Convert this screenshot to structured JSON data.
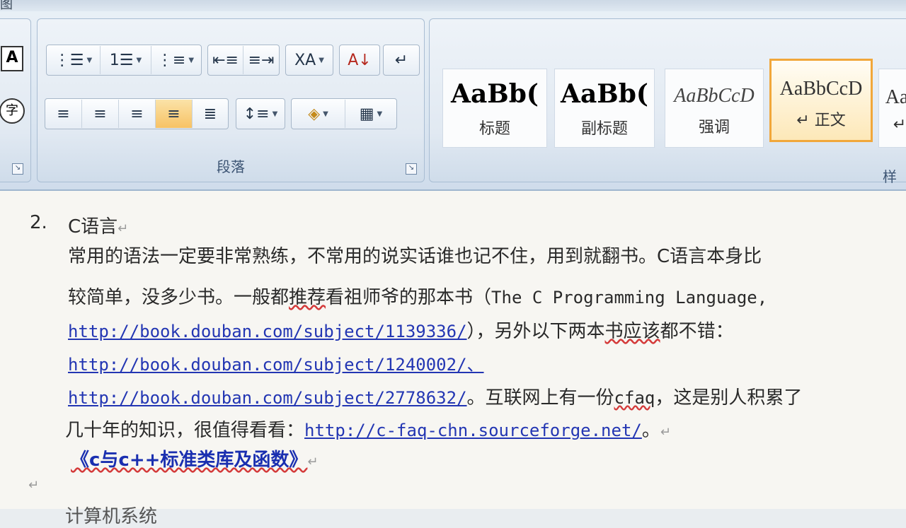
{
  "window": {
    "title": "图"
  },
  "ribbon": {
    "paragraph_group": {
      "label": "段落",
      "row1": [
        {
          "name": "bullets",
          "glyph": "⋮☰"
        },
        {
          "name": "numbering",
          "glyph": "1☰"
        },
        {
          "name": "multilevel",
          "glyph": "⋮≡"
        },
        {
          "name": "decrease-indent",
          "glyph": "⇤≡"
        },
        {
          "name": "increase-indent",
          "glyph": "≡⇥"
        },
        {
          "name": "chinese-layout",
          "glyph": "ⅩA"
        },
        {
          "name": "sort",
          "glyph": "A↓"
        },
        {
          "name": "show-marks",
          "glyph": "↵"
        }
      ],
      "row2": [
        {
          "name": "align-left",
          "glyph": "≡"
        },
        {
          "name": "align-center",
          "glyph": "≡"
        },
        {
          "name": "align-right",
          "glyph": "≡"
        },
        {
          "name": "justify",
          "glyph": "≡"
        },
        {
          "name": "distributed",
          "glyph": "≣"
        },
        {
          "name": "line-spacing",
          "glyph": "↕≡"
        },
        {
          "name": "shading",
          "glyph": "◈"
        },
        {
          "name": "borders",
          "glyph": "▦"
        }
      ]
    },
    "left_group": {
      "glyph_a": "A",
      "glyph_b": "字"
    },
    "styles": [
      {
        "sample": "AaBb(",
        "name": "标题"
      },
      {
        "sample": "AaBb(",
        "name": "副标题"
      },
      {
        "sample": "AaBbCcD",
        "name": "强调"
      },
      {
        "sample": "AaBbCcD",
        "name": "↵ 正文"
      },
      {
        "sample": "Aal",
        "name": "↵"
      }
    ],
    "styles_group_label_partial": "样"
  },
  "document": {
    "list_number": "2.",
    "heading": "C语言",
    "line1": "常用的语法一定要非常熟练，不常用的说实话谁也记不住，用到就翻书。C语言本身比",
    "line2_a": "较简单，没多少书。一般都",
    "line2_wavy": "推荐",
    "line2_b": "看祖师爷的那本书（",
    "line2_mono": "The C Programming Language,",
    "link1": "http://book.douban.com/subject/1139336/",
    "line3_after": "），另外以下两本",
    "line3_wavy": "书应该",
    "line3_tail": "都不错：",
    "link2": "http://book.douban.com/subject/1240002/、",
    "link3": "http://book.douban.com/subject/2778632/",
    "line5_after": "。互联网上有一份",
    "line5_mono": "cfaq",
    "line5_tail": "，这是别人积累了",
    "line6_a": "几十年的知识，很值得看看：",
    "link4": "http://c-faq-chn.sourceforge.net/",
    "line6_tail": "。",
    "book_title": "《c与c++标准类库及函数》",
    "para_mark": "↵",
    "next_item_partial": "计算机系统"
  }
}
